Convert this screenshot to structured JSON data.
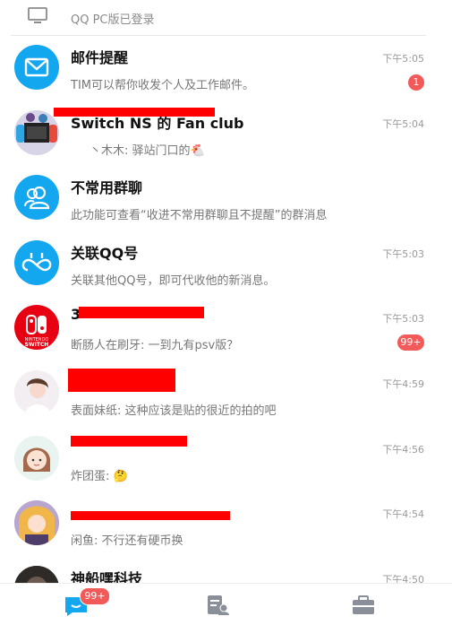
{
  "pc_status": {
    "text": "QQ PC版已登录",
    "icon": "monitor-icon"
  },
  "conversations": [
    {
      "title": "邮件提醒",
      "preview": "TIM可以帮你收发个人及工作邮件。",
      "time": "下午5:05",
      "badge": "1",
      "avatar": "mail-icon",
      "color": "#12a7ee"
    },
    {
      "title": "Switch NS 的 Fan club",
      "preview": "丶木木: 驿站门口的🐔",
      "time": "下午5:04",
      "avatar": "group-avatar",
      "redacted": true
    },
    {
      "title": "不常用群聊",
      "preview": "此功能可查看“收进不常用群聊且不提醒”的群消息",
      "time": "",
      "avatar": "people-icon",
      "color": "#12a7ee"
    },
    {
      "title": "关联QQ号",
      "preview": "关联其他QQ号，即可代收他的新消息。",
      "time": "下午5:03",
      "avatar": "infinity-icon",
      "color": "#12a7ee"
    },
    {
      "title": "3",
      "preview": "断肠人在刷牙: 一到九有psv版？",
      "time": "下午5:03",
      "badge": "99+",
      "avatar": "nintendo-switch-logo",
      "color": "#e60012",
      "redacted": true
    },
    {
      "title": "",
      "preview": "表面妹纸: 这种应该是贴的很近的拍的吧",
      "time": "下午4:59",
      "avatar": "anime-avatar",
      "redacted": true
    },
    {
      "title": "",
      "preview": "炸团蛋: 🤔",
      "time": "下午4:56",
      "avatar": "cartoon-girl-avatar",
      "redacted": true
    },
    {
      "title": "",
      "preview": "闲鱼: 不行还有硬币换",
      "time": "下午4:54",
      "avatar": "anime-avatar-2",
      "redacted": true
    },
    {
      "title": "神船嘿科技",
      "preview": "",
      "time": "下午4:50",
      "avatar": "group-avatar-dark"
    }
  ],
  "tabbar": {
    "messages_badge": "99+",
    "accent": "#12a7ee",
    "inactive": "#8a8f99"
  }
}
